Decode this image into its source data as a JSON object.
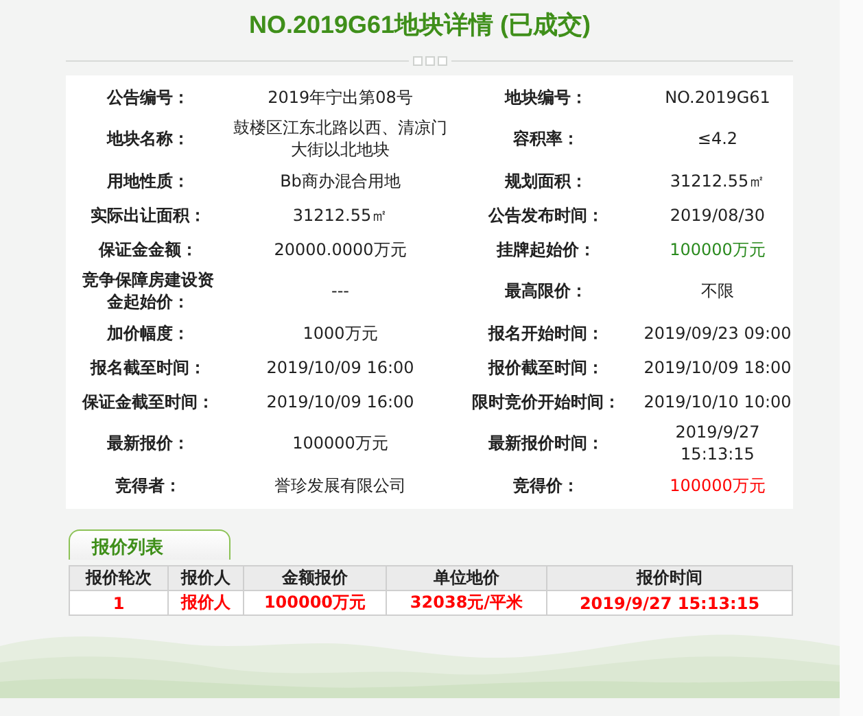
{
  "title": "NO.2019G61地块详情 (已成交)",
  "details": [
    {
      "cells": [
        {
          "label": "公告编号：",
          "value": "2019年宁出第08号"
        },
        {
          "label": "地块编号：",
          "value": "NO.2019G61"
        }
      ]
    },
    {
      "cells": [
        {
          "label": "地块名称：",
          "value": "鼓楼区江东北路以西、清凉门大街以北地块"
        },
        {
          "label": "容积率：",
          "value": "≤4.2"
        }
      ]
    },
    {
      "cells": [
        {
          "label": "用地性质：",
          "value": "Bb商办混合用地"
        },
        {
          "label": "规划面积：",
          "value": "31212.55㎡"
        }
      ]
    },
    {
      "cells": [
        {
          "label": "实际出让面积：",
          "value": "31212.55㎡"
        },
        {
          "label": "公告发布时间：",
          "value": "2019/08/30"
        }
      ]
    },
    {
      "cells": [
        {
          "label": "保证金金额：",
          "value": "20000.0000万元"
        },
        {
          "label": "挂牌起始价：",
          "value": "100000万元",
          "color": "#2a8a1e"
        }
      ]
    },
    {
      "cells": [
        {
          "label": "竞争保障房建设资金起始价：",
          "value": "---"
        },
        {
          "label": "最高限价：",
          "value": "不限"
        }
      ]
    },
    {
      "cells": [
        {
          "label": "加价幅度：",
          "value": "1000万元"
        },
        {
          "label": "报名开始时间：",
          "value": "2019/09/23 09:00"
        }
      ]
    },
    {
      "cells": [
        {
          "label": "报名截至时间：",
          "value": "2019/10/09 16:00"
        },
        {
          "label": "报价截至时间：",
          "value": "2019/10/09 18:00"
        }
      ]
    },
    {
      "cells": [
        {
          "label": "保证金截至时间：",
          "value": "2019/10/09 16:00"
        },
        {
          "label": "限时竞价开始时间：",
          "value": "2019/10/10 10:00"
        }
      ]
    },
    {
      "cells": [
        {
          "label": "最新报价：",
          "value": "100000万元"
        },
        {
          "label": "最新报价时间：",
          "value": "2019/9/27\n15:13:15"
        }
      ]
    },
    {
      "cells": [
        {
          "label": "竞得者：",
          "value": "誉珍发展有限公司"
        },
        {
          "label": "竞得价：",
          "value": "100000万元",
          "color": "#ff0000"
        }
      ]
    }
  ],
  "quote_list": {
    "tab": "报价列表",
    "columns": [
      "报价轮次",
      "报价人",
      "金额报价",
      "单位地价",
      "报价时间"
    ],
    "rows": [
      [
        "1",
        "报价人",
        "100000万元",
        "32038元/平米",
        "2019/9/27 15:13:15"
      ]
    ]
  }
}
